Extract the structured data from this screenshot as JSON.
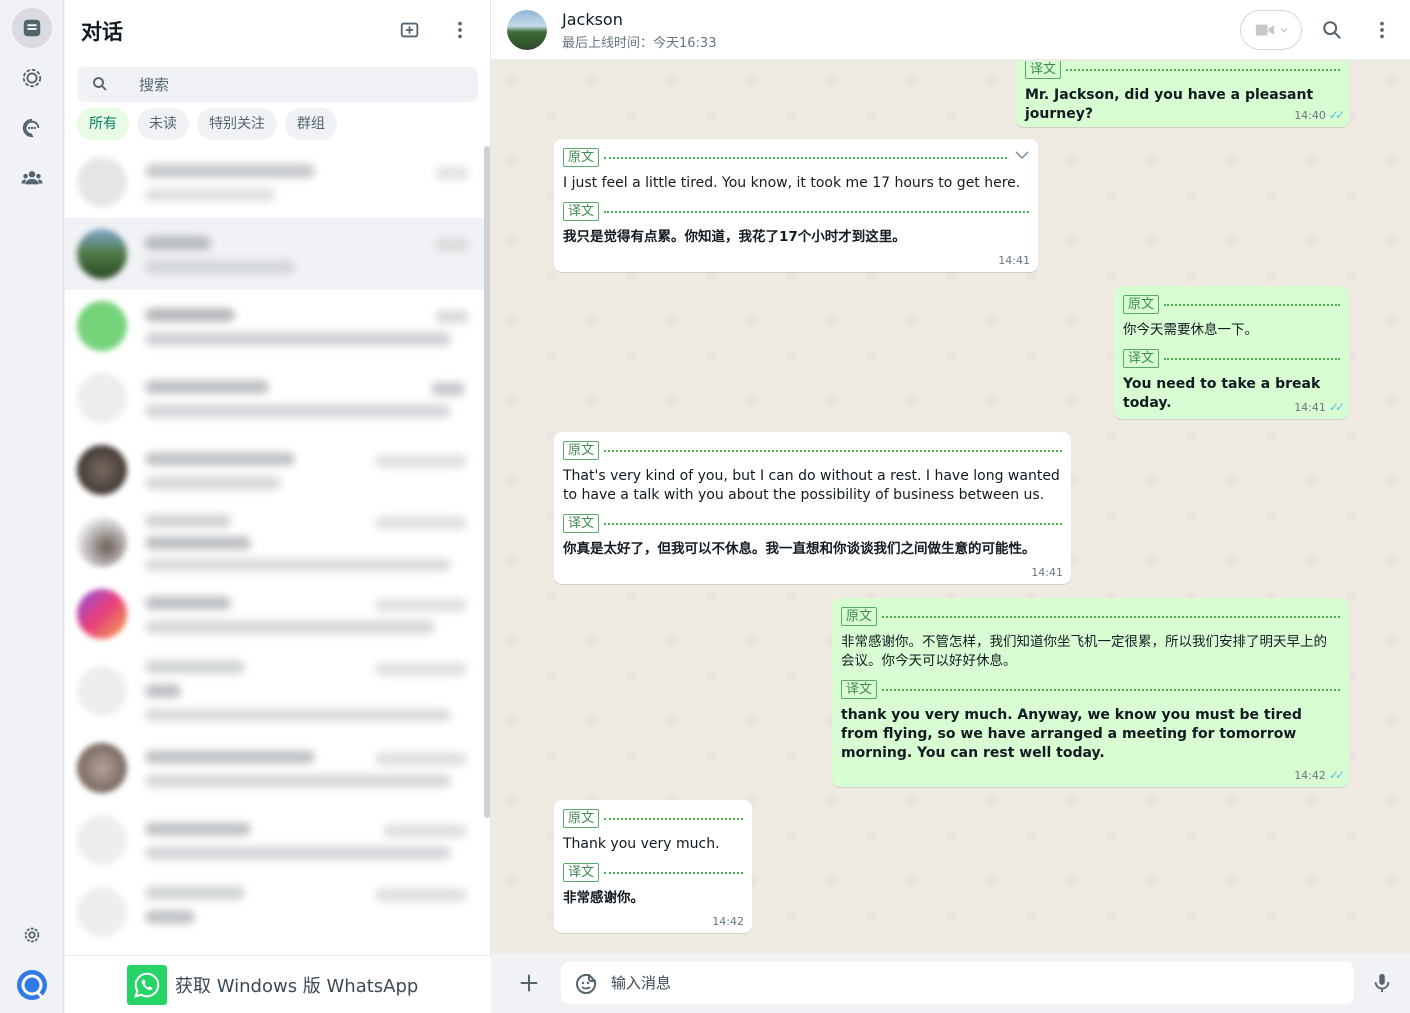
{
  "sidebar_rail": {
    "icons": [
      "chats-icon",
      "status-icon",
      "channels-icon",
      "communities-icon",
      "settings-icon",
      "profile-icon"
    ]
  },
  "chat_list_panel": {
    "title": "对话",
    "search": {
      "placeholder": "搜索",
      "value": ""
    },
    "filters": [
      {
        "label": "所有",
        "active": true
      },
      {
        "label": "未读",
        "active": false
      },
      {
        "label": "特别关注",
        "active": false
      },
      {
        "label": "群组",
        "active": false
      }
    ],
    "promo": {
      "text": "获取 Windows 版 WhatsApp"
    }
  },
  "conversation": {
    "contact_name": "Jackson",
    "last_seen": "最后上线时间：今天16:33",
    "composer_placeholder": "输入消息",
    "tag_original": "原文",
    "tag_translation": "译文",
    "messages": [
      {
        "direction": "out",
        "translation": "Mr. Jackson, did you have a pleasant journey?",
        "time": "14:40",
        "read": true
      },
      {
        "direction": "in",
        "original": "I just feel a little tired. You know, it took me 17 hours to get here.",
        "translation": "我只是觉得有点累。你知道，我花了17个小时才到这里。",
        "time": "14:41"
      },
      {
        "direction": "out",
        "original": "你今天需要休息一下。",
        "translation": "You need to take a break today.",
        "time": "14:41",
        "read": true
      },
      {
        "direction": "in",
        "original": "That's very kind of you, but I can do without a rest. I have long wanted to have a talk with you about the possibility of business between us.",
        "translation": "你真是太好了，但我可以不休息。我一直想和你谈谈我们之间做生意的可能性。",
        "time": "14:41"
      },
      {
        "direction": "out",
        "original": "非常感谢你。不管怎样，我们知道你坐飞机一定很累，所以我们安排了明天早上的会议。你今天可以好好休息。",
        "translation": "thank you very much. Anyway, we know you must be tired from flying, so we have arranged a meeting for tomorrow morning. You can rest well today.",
        "time": "14:42",
        "read": true
      },
      {
        "direction": "in",
        "original": "Thank you very much.",
        "translation": "非常感谢你。",
        "time": "14:42"
      }
    ]
  },
  "colors": {
    "accent": "#25d366",
    "outgoing_bubble": "#d9fdd3",
    "incoming_bubble": "#ffffff",
    "chat_background": "#efeae2",
    "read_ticks": "#53bdeb",
    "tag_border": "#59a96a"
  }
}
